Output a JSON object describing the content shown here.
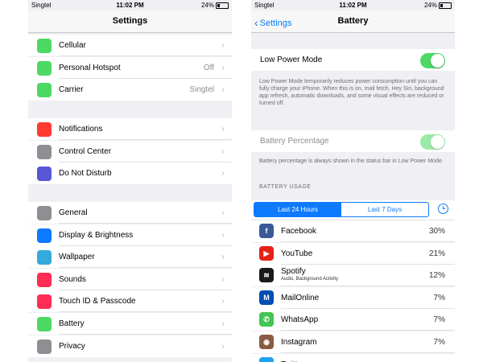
{
  "left": {
    "status": {
      "carrier": "Singtel",
      "time": "11:02 PM",
      "battery": "24%"
    },
    "title": "Settings",
    "groups": [
      [
        {
          "label": "Cellular",
          "value": "",
          "icon": "antenna-icon",
          "color": "#4cd964"
        },
        {
          "label": "Personal Hotspot",
          "value": "Off",
          "icon": "hotspot-icon",
          "color": "#4cd964"
        },
        {
          "label": "Carrier",
          "value": "Singtel",
          "icon": "phone-icon",
          "color": "#4cd964"
        }
      ],
      [
        {
          "label": "Notifications",
          "value": "",
          "icon": "notifications-icon",
          "color": "#ff3b30"
        },
        {
          "label": "Control Center",
          "value": "",
          "icon": "control-center-icon",
          "color": "#8e8e93"
        },
        {
          "label": "Do Not Disturb",
          "value": "",
          "icon": "moon-icon",
          "color": "#5856d6"
        }
      ],
      [
        {
          "label": "General",
          "value": "",
          "icon": "gear-icon",
          "color": "#8e8e93"
        },
        {
          "label": "Display & Brightness",
          "value": "",
          "icon": "display-icon",
          "color": "#0e7afe"
        },
        {
          "label": "Wallpaper",
          "value": "",
          "icon": "wallpaper-icon",
          "color": "#34aadc"
        },
        {
          "label": "Sounds",
          "value": "",
          "icon": "speaker-icon",
          "color": "#ff2d55"
        },
        {
          "label": "Touch ID & Passcode",
          "value": "",
          "icon": "fingerprint-icon",
          "color": "#ff2d55"
        },
        {
          "label": "Battery",
          "value": "",
          "icon": "battery-icon",
          "color": "#4cd964"
        },
        {
          "label": "Privacy",
          "value": "",
          "icon": "hand-icon",
          "color": "#8e8e93"
        }
      ]
    ]
  },
  "right": {
    "status": {
      "carrier": "Singtel",
      "time": "11:02 PM",
      "battery": "24%"
    },
    "back_label": "Settings",
    "title": "Battery",
    "low_power": {
      "label": "Low Power Mode",
      "on": true,
      "description": "Low Power Mode temporarily reduces power consumption until you can fully charge your iPhone. When this is on, mail fetch, Hey Siri, background app refresh, automatic downloads, and some visual effects are reduced or turned off."
    },
    "battery_percentage": {
      "label": "Battery Percentage",
      "on": true,
      "description": "Battery percentage is always shown in the status bar in Low Power Mode."
    },
    "usage_header": "BATTERY USAGE",
    "segments": [
      "Last 24 Hours",
      "Last 7 Days"
    ],
    "apps": [
      {
        "name": "Facebook",
        "sub": "",
        "pct": "30%",
        "icon": "facebook-icon",
        "glyph": "f",
        "color": "#3b5998"
      },
      {
        "name": "YouTube",
        "sub": "",
        "pct": "21%",
        "icon": "youtube-icon",
        "glyph": "▶",
        "color": "#e62117"
      },
      {
        "name": "Spotify",
        "sub": "Audio, Background Activity",
        "pct": "12%",
        "icon": "spotify-icon",
        "glyph": "≋",
        "color": "#1a1a1a"
      },
      {
        "name": "MailOnline",
        "sub": "",
        "pct": "7%",
        "icon": "mailonline-icon",
        "glyph": "M",
        "color": "#004db3"
      },
      {
        "name": "WhatsApp",
        "sub": "",
        "pct": "7%",
        "icon": "whatsapp-icon",
        "glyph": "✆",
        "color": "#43c553"
      },
      {
        "name": "Instagram",
        "sub": "",
        "pct": "7%",
        "icon": "instagram-icon",
        "glyph": "◉",
        "color": "#8a5a44"
      },
      {
        "name": "Twitter",
        "sub": "",
        "pct": "",
        "icon": "twitter-icon",
        "glyph": "t",
        "color": "#1da1f2"
      }
    ]
  }
}
